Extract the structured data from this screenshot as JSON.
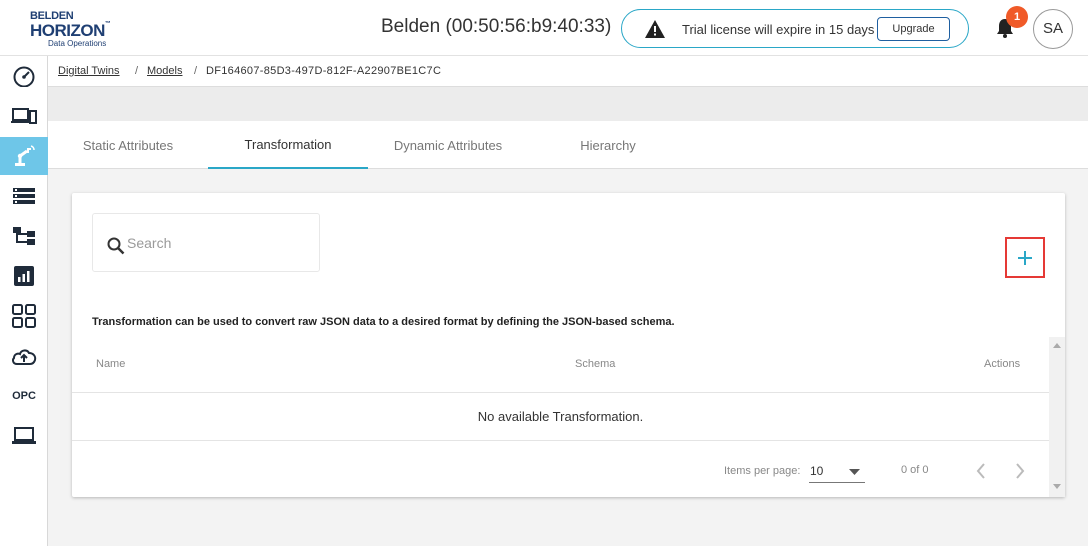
{
  "header": {
    "logo": {
      "line1": "BELDEN",
      "line2": "HORIZON",
      "tm": "™",
      "line3": "Data Operations"
    },
    "device_title": "Belden (00:50:56:b9:40:33)",
    "trial_message": "Trial license will expire in 15 days",
    "upgrade_label": "Upgrade",
    "notification_count": "1",
    "avatar_initials": "SA"
  },
  "sidebar": {
    "items": [
      {
        "icon": "dashboard-icon"
      },
      {
        "icon": "devices-icon"
      },
      {
        "icon": "robot-arm-icon",
        "active": true
      },
      {
        "icon": "list-icon"
      },
      {
        "icon": "hierarchy-icon"
      },
      {
        "icon": "chart-icon"
      },
      {
        "icon": "apps-grid-icon"
      },
      {
        "icon": "cloud-upload-icon"
      },
      {
        "icon": "opc-icon",
        "label": "OPC"
      },
      {
        "icon": "laptop-icon"
      }
    ]
  },
  "breadcrumb": {
    "items": [
      "Digital Twins",
      "Models"
    ],
    "separator": "/",
    "current": "DF164607-85D3-497D-812F-A22907BE1C7C"
  },
  "tabs": [
    "Static Attributes",
    "Transformation",
    "Dynamic Attributes",
    "Hierarchy"
  ],
  "active_tab": "Transformation",
  "card": {
    "search_placeholder": "Search",
    "description": "Transformation can be used to convert raw JSON data to a desired format by defining the JSON-based schema.",
    "columns": [
      "Name",
      "Schema",
      "Actions"
    ],
    "empty_message": "No available Transformation.",
    "pager": {
      "items_per_page_label": "Items per page:",
      "items_per_page_value": "10",
      "range_label": "0 of 0"
    }
  },
  "colors": {
    "accent": "#2aa7c7",
    "sidebar_active": "#6ec6e8",
    "badge": "#f05a28",
    "highlight_border": "#e53935",
    "brand": "#1f3f73"
  }
}
